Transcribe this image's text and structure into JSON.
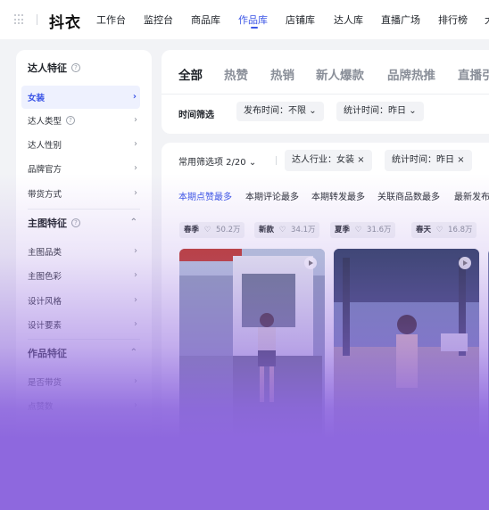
{
  "nav": {
    "logo": "抖衣",
    "items": [
      "工作台",
      "监控台",
      "商品库",
      "作品库",
      "店铺库",
      "达人库",
      "直播广场",
      "排行榜",
      "大"
    ],
    "active_index": 3
  },
  "sidebar": {
    "sections": [
      {
        "title": "达人特征",
        "items": [
          {
            "label": "女装",
            "selected": true
          },
          {
            "label": "达人类型",
            "help": true
          },
          {
            "label": "达人性别"
          },
          {
            "label": "品牌官方"
          },
          {
            "label": "带货方式"
          }
        ]
      },
      {
        "title": "主图特征",
        "items": [
          {
            "label": "主图品类"
          },
          {
            "label": "主图色彩"
          },
          {
            "label": "设计风格"
          },
          {
            "label": "设计要素"
          }
        ]
      },
      {
        "title": "作品特征",
        "items": [
          {
            "label": "是否带货"
          },
          {
            "label": "点赞数"
          }
        ]
      }
    ]
  },
  "tabs": {
    "items": [
      "全部",
      "热赞",
      "热销",
      "新人爆款",
      "品牌热推",
      "直播引"
    ],
    "active_index": 0
  },
  "time_filter": {
    "label": "时间筛选",
    "publish": "发布时间：不限",
    "stat": "统计时间：昨日"
  },
  "common_filter": {
    "label": "常用筛选项 2/20",
    "chips": [
      "达人行业：女装",
      "统计时间：昨日"
    ]
  },
  "sort_tabs": {
    "items": [
      "本期点赞最多",
      "本期评论最多",
      "本期转发最多",
      "关联商品数最多",
      "最新发布"
    ],
    "active_index": 0
  },
  "keywords": [
    {
      "word": "春季",
      "count": "50.2万"
    },
    {
      "word": "新款",
      "count": "34.1万"
    },
    {
      "word": "夏季",
      "count": "31.6万"
    },
    {
      "word": "春天",
      "count": "16.8万"
    }
  ],
  "icons": {
    "chevron_right": "›",
    "chevron_down": "⌄",
    "chevron_up": "⌃",
    "close": "×",
    "help": "?"
  },
  "colors": {
    "accent": "#3b55e6",
    "overlay": "#8e68de"
  }
}
